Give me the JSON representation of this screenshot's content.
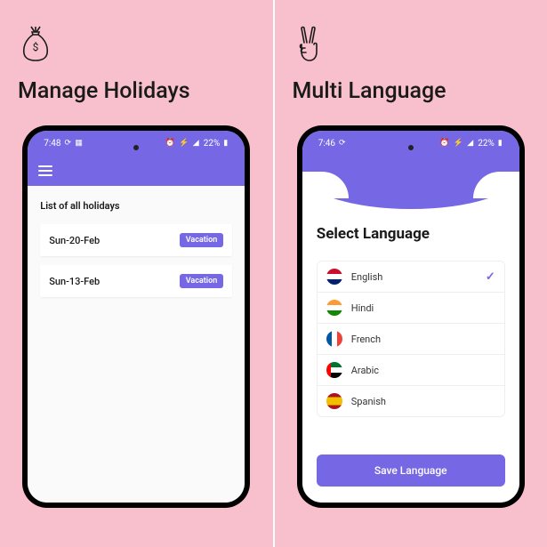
{
  "left": {
    "title": "Manage Holidays",
    "status_time": "7:48",
    "status_right": "22%",
    "list_heading": "List of all holidays",
    "holidays": [
      {
        "date": "Sun-20-Feb",
        "badge": "Vacation"
      },
      {
        "date": "Sun-13-Feb",
        "badge": "Vacation"
      }
    ]
  },
  "right": {
    "title": "Multi Language",
    "status_time": "7:46",
    "status_right": "22%",
    "heading": "Select Language",
    "languages": [
      {
        "name": "English",
        "selected": true
      },
      {
        "name": "Hindi",
        "selected": false
      },
      {
        "name": "French",
        "selected": false
      },
      {
        "name": "Arabic",
        "selected": false
      },
      {
        "name": "Spanish",
        "selected": false
      }
    ],
    "save_label": "Save Language"
  }
}
